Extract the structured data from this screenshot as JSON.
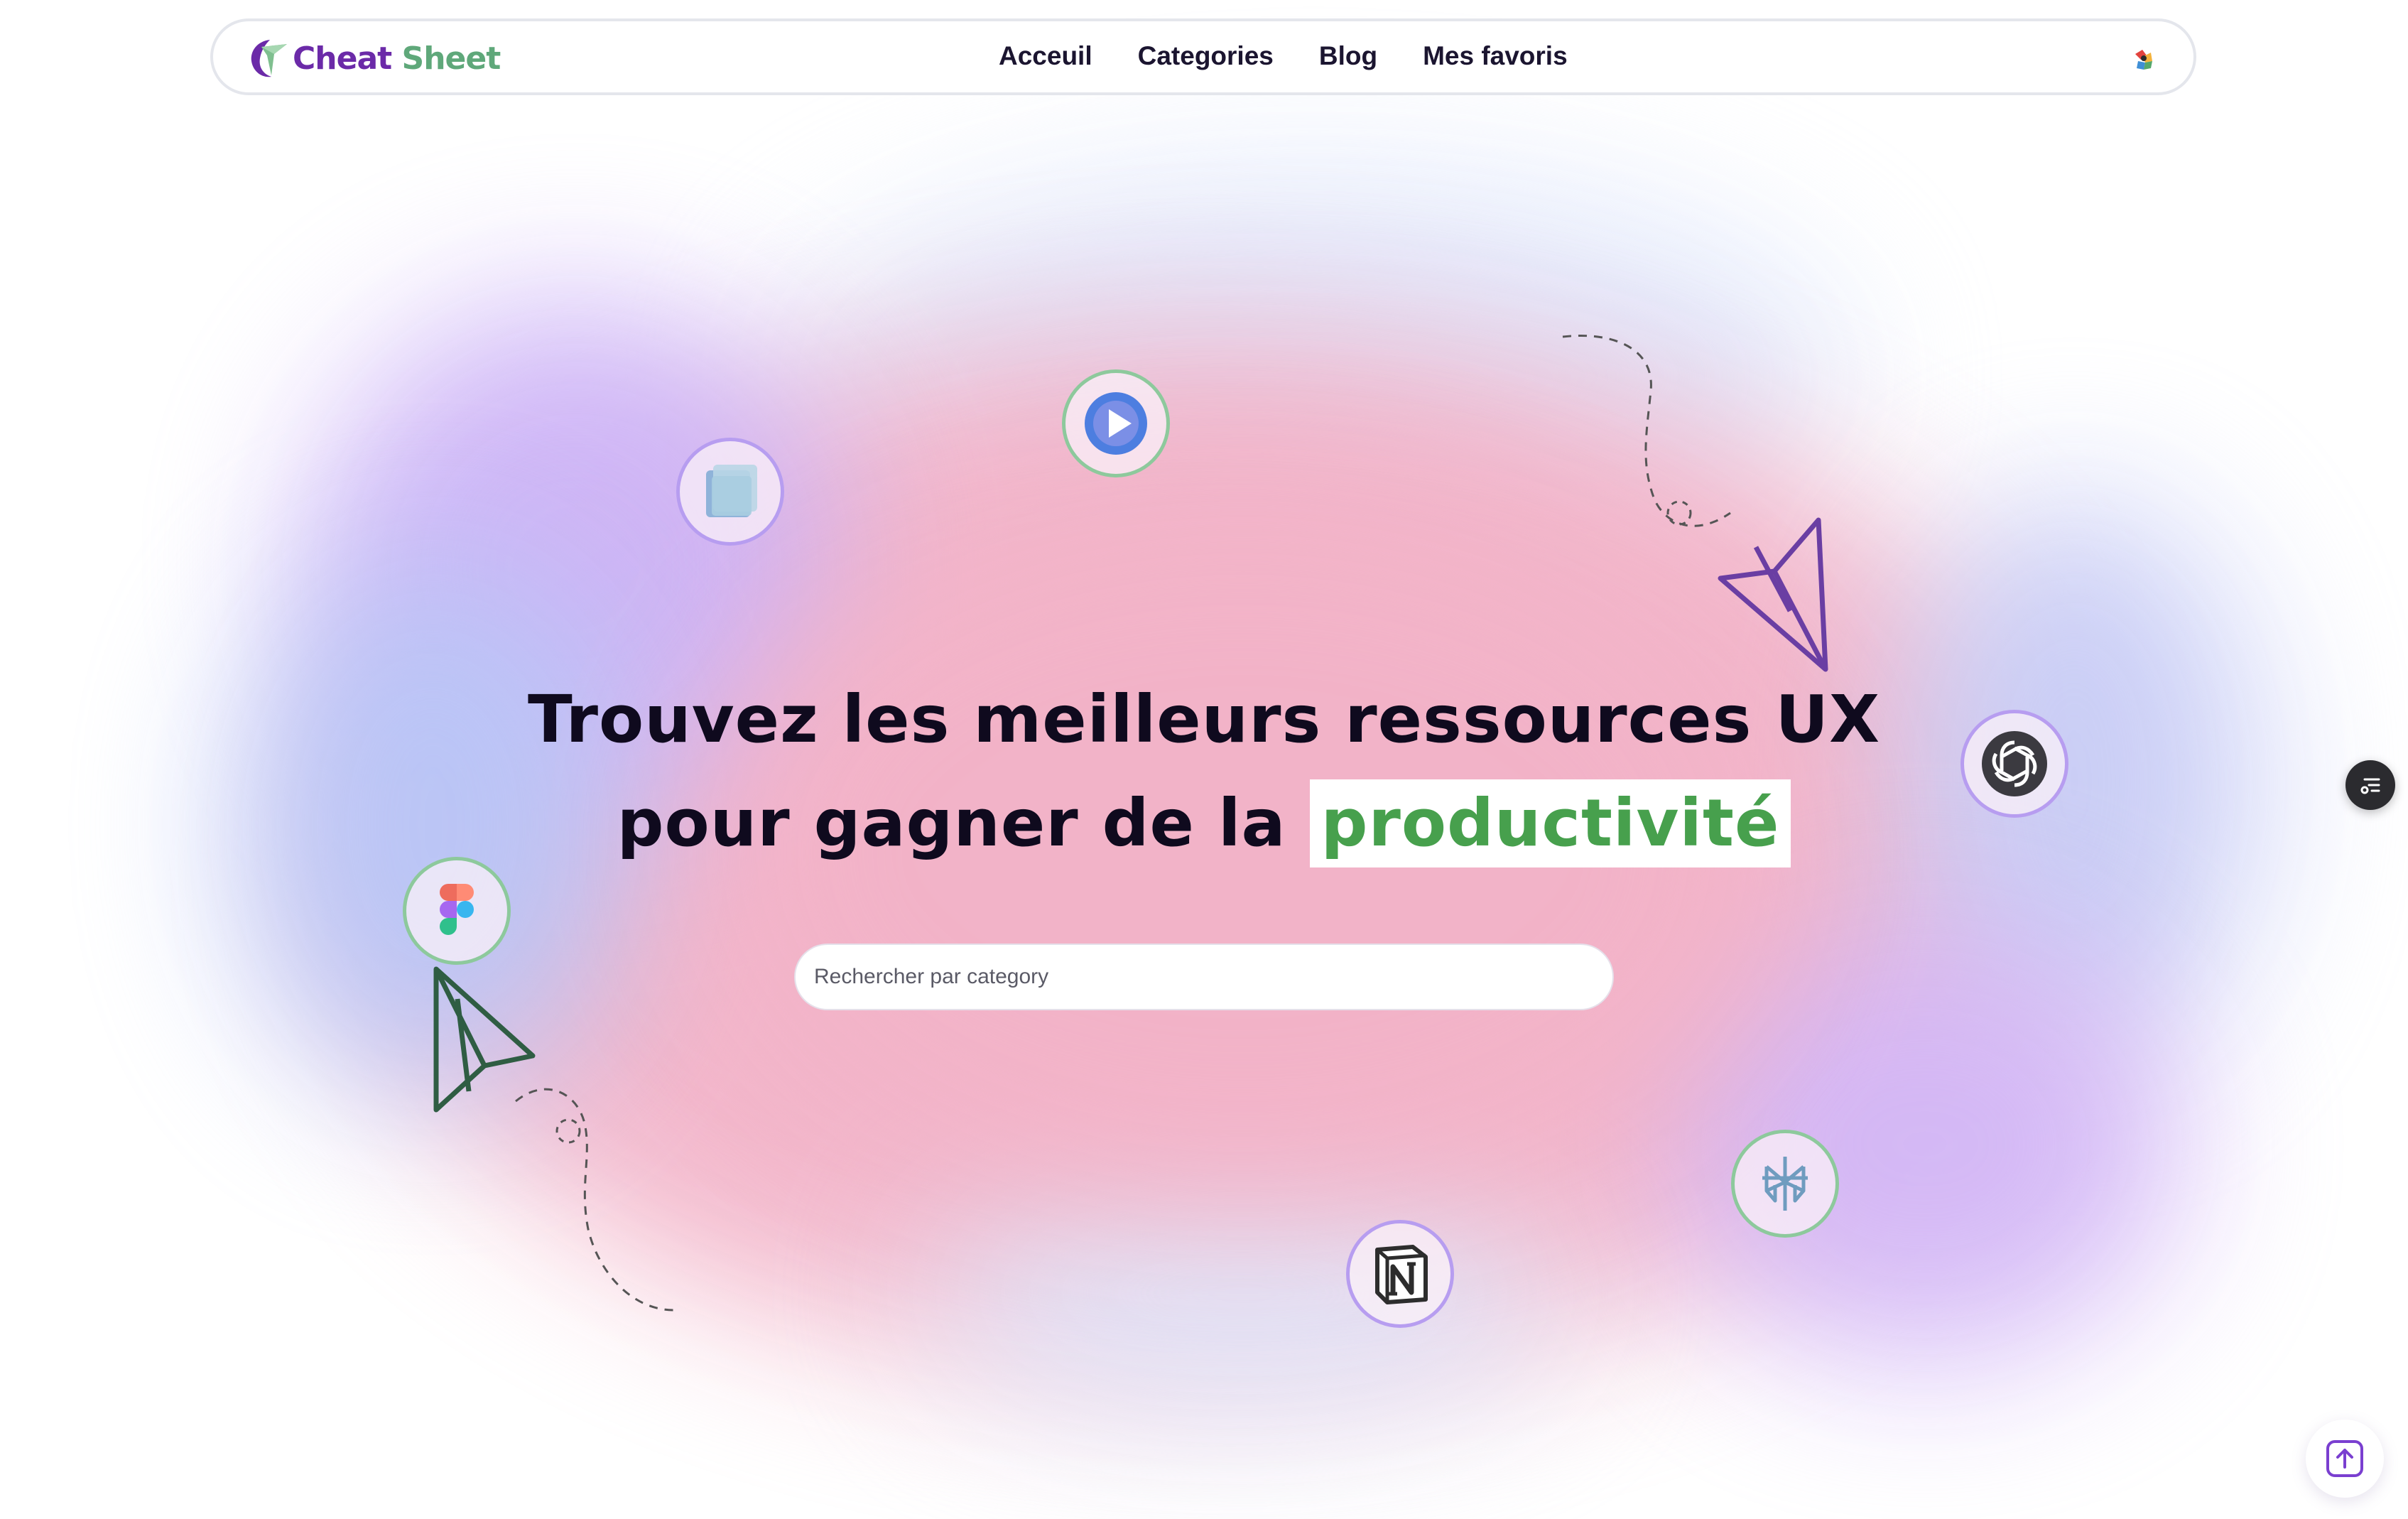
{
  "brand": {
    "name_part1": "Cheat",
    "name_part2": "Sheet",
    "color_primary": "#6b2aa8",
    "color_secondary": "#5fa87a"
  },
  "nav": {
    "items": [
      {
        "label": "Acceuil"
      },
      {
        "label": "Categories"
      },
      {
        "label": "Blog"
      },
      {
        "label": "Mes favoris"
      }
    ],
    "avatar_icon": "user-avatar-icon"
  },
  "hero": {
    "title_line1": "Trouvez les meilleurs ressources UX",
    "title_line2_prefix": "pour gagner de la",
    "title_highlight": "productivité",
    "highlight_color": "#47a04d"
  },
  "search": {
    "placeholder": "Rechercher par category"
  },
  "tools": [
    {
      "name": "glass-layers-app-icon"
    },
    {
      "name": "play-video-app-icon"
    },
    {
      "name": "openai-chatgpt-icon"
    },
    {
      "name": "figma-icon"
    },
    {
      "name": "perplexity-icon"
    },
    {
      "name": "notion-icon"
    }
  ],
  "floating": {
    "menu_icon": "list-settings-icon",
    "scroll_top_icon": "arrow-up-square-icon"
  }
}
